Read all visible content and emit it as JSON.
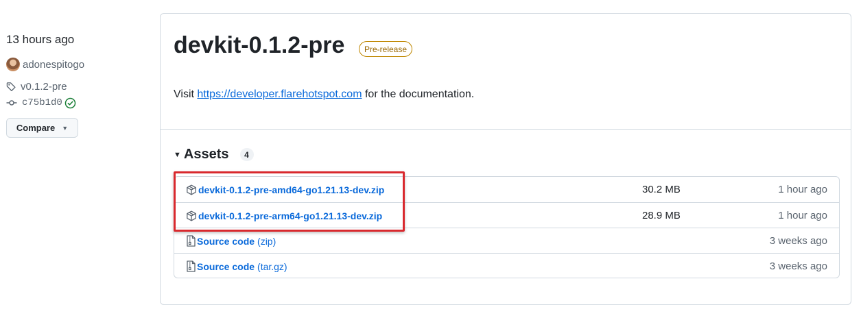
{
  "meta": {
    "time": "13 hours ago",
    "author": "adonespitogo",
    "tag": "v0.1.2-pre",
    "commit": "c75b1d0",
    "compare_label": "Compare"
  },
  "release": {
    "title": "devkit-0.1.2-pre",
    "badge": "Pre-release",
    "description_prefix": "Visit ",
    "description_link": "https://developer.flarehotspot.com",
    "description_suffix": " for the documentation."
  },
  "assets": {
    "label": "Assets",
    "count": "4",
    "items": [
      {
        "name": "devkit-0.1.2-pre-amd64-go1.21.13-dev.zip",
        "suffix": "",
        "icon": "package-icon",
        "size": "30.2 MB",
        "date": "1 hour ago"
      },
      {
        "name": "devkit-0.1.2-pre-arm64-go1.21.13-dev.zip",
        "suffix": "",
        "icon": "package-icon",
        "size": "28.9 MB",
        "date": "1 hour ago"
      },
      {
        "name": "Source code",
        "suffix": "(zip)",
        "icon": "file-zip-icon",
        "size": "",
        "date": "3 weeks ago"
      },
      {
        "name": "Source code",
        "suffix": "(tar.gz)",
        "icon": "file-zip-icon",
        "size": "",
        "date": "3 weeks ago"
      }
    ]
  },
  "colors": {
    "link": "#0969da",
    "border": "#d1d9e0",
    "prerelease": "#9a6700",
    "highlight": "#d9292e",
    "success": "#1a7f37"
  }
}
